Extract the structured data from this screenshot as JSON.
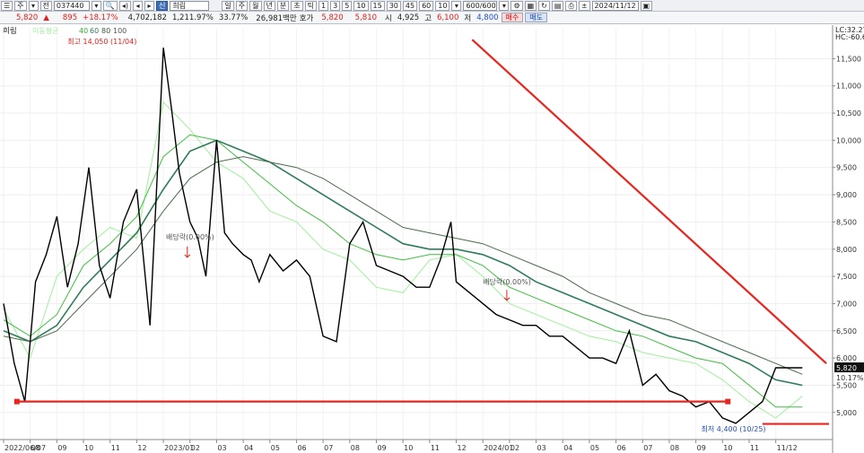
{
  "toolbar": {
    "menu_icon": "grid-menu-icon",
    "btn_type": "주",
    "btn_all": "전",
    "stock_code": "037440",
    "btn_credit": "신",
    "stock_name": "희림",
    "period_buttons": [
      "일",
      "주",
      "월",
      "년",
      "분",
      "초",
      "틱"
    ],
    "interval_buttons": [
      "1",
      "3",
      "5",
      "10",
      "15",
      "30",
      "45",
      "60",
      "10"
    ],
    "count_value": "600/600",
    "date_value": "2024/11/12"
  },
  "quote": {
    "price": "5,820",
    "change_arrow": "▲",
    "change": "895",
    "change_pct": "+18.17%",
    "volume": "4,702,182",
    "volume_ratio": "1,211.97%",
    "turnover_pct": "33.77%",
    "amount": "26,981백만",
    "ask_label": "호가",
    "ask": "5,820",
    "bid": "5,810",
    "open_label": "시",
    "open": "4,925",
    "high_label": "고",
    "high": "6,100",
    "low_label": "저",
    "low": "4,800",
    "buy_label": "매수",
    "sell_label": "매도"
  },
  "colors": {
    "price_line": "#000000",
    "trend_line": "#e8251e",
    "ma_light": "#9ff09a",
    "ma_mid": "#3fbf3f",
    "ma_dark": "#2e7d5a",
    "ma_darkest": "#4c6b4c"
  },
  "chart_data": {
    "type": "line",
    "title": "희림",
    "legend": {
      "label": "희림",
      "ma_label": "이동평균",
      "ma_periods": [
        "5",
        "20",
        "40",
        "60",
        "80",
        "100"
      ]
    },
    "header_right": [
      "LC:32.27",
      "HC:-60.6"
    ],
    "y_axis": {
      "ticks": [
        "11,500",
        "11,000",
        "10,500",
        "10,000",
        "9,500",
        "9,000",
        "8,500",
        "8,000",
        "7,500",
        "7,000",
        "6,500",
        "6,000",
        "5,500",
        "5,000"
      ],
      "range": [
        4700,
        12050
      ],
      "current_label": "5,820",
      "current_pct": "10.17%"
    },
    "x_axis": {
      "ticks": [
        "2022/06/07",
        "08",
        "09",
        "10",
        "11",
        "12",
        "2023/01",
        "02",
        "03",
        "04",
        "05",
        "06",
        "07",
        "08",
        "09",
        "10",
        "11",
        "12",
        "2024/01",
        "02",
        "03",
        "04",
        "05",
        "06",
        "07",
        "08",
        "09",
        "10",
        "11",
        "11/12"
      ]
    },
    "annotations": {
      "high": "최고 14,050 (11/04)",
      "low": "최저 4,400 (10/25)",
      "dividend1": "배당락(0.00%)",
      "dividend2": "배당락(0.00%)"
    },
    "trend_lines": [
      {
        "name": "resistance",
        "from": [
          17.6,
          11850
        ],
        "to": [
          30.9,
          5900
        ]
      },
      {
        "name": "support",
        "from": [
          0.5,
          5200
        ],
        "to": [
          27.2,
          5200
        ]
      },
      {
        "name": "low-support",
        "from": [
          28.5,
          4790
        ],
        "to": [
          31.0,
          4790
        ]
      }
    ],
    "series": [
      {
        "name": "희림",
        "x": [
          0,
          0.4,
          0.8,
          1.2,
          1.6,
          2,
          2.4,
          2.8,
          3.2,
          3.6,
          4,
          4.5,
          5,
          5.5,
          6,
          6.3,
          6.6,
          7,
          7.3,
          7.6,
          8,
          8.3,
          8.6,
          9,
          9.3,
          9.6,
          10,
          10.5,
          11,
          11.5,
          12,
          12.5,
          13,
          13.5,
          14,
          14.5,
          15,
          15.5,
          16,
          16.4,
          16.8,
          17,
          17.5,
          18,
          18.5,
          19,
          19.5,
          20,
          20.5,
          21,
          21.5,
          22,
          22.5,
          23,
          23.5,
          24,
          24.5,
          25,
          25.5,
          26,
          26.5,
          27,
          27.5,
          28,
          28.5,
          29,
          29.5,
          30
        ],
        "y": [
          7000,
          5900,
          5200,
          7400,
          7900,
          8600,
          7300,
          8100,
          9500,
          7700,
          7100,
          8500,
          9100,
          6600,
          11700,
          10600,
          9400,
          8500,
          8200,
          7500,
          10000,
          8300,
          8100,
          7900,
          7800,
          7400,
          7900,
          7600,
          7800,
          7500,
          6400,
          6300,
          8100,
          8500,
          7700,
          7600,
          7500,
          7300,
          7300,
          7800,
          8500,
          7400,
          7200,
          7000,
          6800,
          6700,
          6600,
          6600,
          6400,
          6400,
          6200,
          6000,
          6000,
          5900,
          6500,
          5500,
          5700,
          5400,
          5300,
          5100,
          5200,
          4900,
          4800,
          5000,
          5200,
          5820,
          5820,
          5820
        ]
      },
      {
        "name": "MA5",
        "x": [
          0,
          1,
          2,
          3,
          4,
          5,
          6,
          7,
          8,
          9,
          10,
          11,
          12,
          13,
          14,
          15,
          16,
          17,
          18,
          19,
          20,
          21,
          22,
          23,
          24,
          25,
          26,
          27,
          28,
          29,
          30
        ],
        "y": [
          6900,
          6000,
          7500,
          8000,
          8400,
          8200,
          10700,
          10200,
          9600,
          9300,
          8700,
          8500,
          8000,
          7800,
          7300,
          7200,
          7800,
          7900,
          7500,
          7000,
          6800,
          6600,
          6400,
          6300,
          6100,
          6000,
          5900,
          5600,
          5200,
          4900,
          5300
        ]
      },
      {
        "name": "MA20",
        "x": [
          0,
          1,
          2,
          3,
          4,
          5,
          6,
          7,
          8,
          9,
          10,
          11,
          12,
          13,
          14,
          15,
          16,
          17,
          18,
          19,
          20,
          21,
          22,
          23,
          24,
          25,
          26,
          27,
          28,
          29,
          30
        ],
        "y": [
          6700,
          6400,
          6800,
          7700,
          8100,
          8600,
          9700,
          10100,
          10000,
          9600,
          9200,
          8800,
          8500,
          8100,
          7900,
          7800,
          7900,
          7900,
          7700,
          7300,
          7100,
          6900,
          6700,
          6500,
          6400,
          6200,
          6000,
          5900,
          5500,
          5100,
          5100
        ]
      },
      {
        "name": "MA60",
        "x": [
          0,
          1,
          2,
          3,
          4,
          5,
          6,
          7,
          8,
          9,
          10,
          11,
          12,
          13,
          14,
          15,
          16,
          17,
          18,
          19,
          20,
          21,
          22,
          23,
          24,
          25,
          26,
          27,
          28,
          29,
          30
        ],
        "y": [
          6500,
          6300,
          6600,
          7300,
          7800,
          8300,
          9100,
          9800,
          10000,
          9800,
          9600,
          9300,
          9000,
          8700,
          8400,
          8100,
          8000,
          8000,
          7900,
          7700,
          7400,
          7200,
          7000,
          6800,
          6600,
          6400,
          6300,
          6100,
          5900,
          5600,
          5500
        ]
      },
      {
        "name": "MA100",
        "x": [
          0,
          1,
          2,
          3,
          4,
          5,
          6,
          7,
          8,
          9,
          10,
          11,
          12,
          13,
          14,
          15,
          16,
          17,
          18,
          19,
          20,
          21,
          22,
          23,
          24,
          25,
          26,
          27,
          28,
          29,
          30
        ],
        "y": [
          6400,
          6300,
          6500,
          7000,
          7500,
          8000,
          8700,
          9300,
          9600,
          9700,
          9600,
          9500,
          9300,
          9000,
          8700,
          8400,
          8300,
          8200,
          8100,
          7900,
          7700,
          7500,
          7200,
          7000,
          6800,
          6700,
          6500,
          6300,
          6100,
          5900,
          5700
        ]
      }
    ]
  }
}
